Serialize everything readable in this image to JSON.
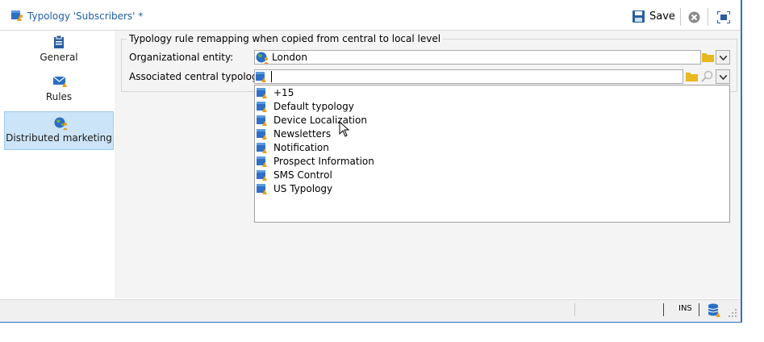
{
  "window": {
    "title": "Typology 'Subscribers' *",
    "save_label": "Save"
  },
  "sidebar": {
    "items": [
      {
        "label": "General",
        "icon": "clipboard-icon"
      },
      {
        "label": "Rules",
        "icon": "envelope-rules-icon"
      },
      {
        "label": "Distributed marketing",
        "icon": "globe-user-icon",
        "selected": true
      }
    ]
  },
  "main": {
    "group_title": "Typology rule remapping when copied from central to local level",
    "org_entity": {
      "label": "Organizational entity:",
      "value": "London"
    },
    "central_typology": {
      "label": "Associated central typology:",
      "value": ""
    }
  },
  "dropdown": {
    "options": [
      "+15",
      "Default typology",
      "Device Localization",
      "Newsletters",
      "Notification",
      "Prospect Information",
      "SMS Control",
      "US Typology"
    ]
  },
  "status": {
    "mode": "INS"
  },
  "colors": {
    "accent": "#2b73c7",
    "title": "#1f5fa8",
    "selected_bg": "#cce4f7",
    "folder": "#e8b820"
  }
}
